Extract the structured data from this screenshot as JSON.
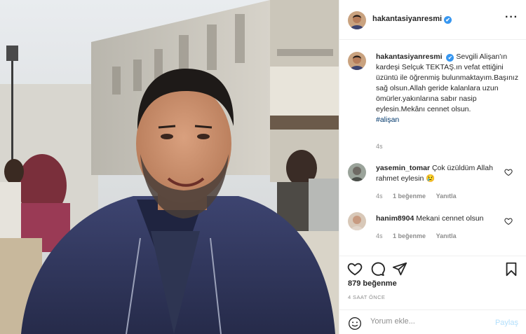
{
  "post": {
    "username": "hakantasiyanresmi",
    "verified_mark": "✔",
    "more_icon": "more-horizontal-icon",
    "colors": {
      "verified": "#3897f0",
      "link": "#00376b",
      "muted": "#8e8e8e",
      "border": "#efefef"
    }
  },
  "caption": {
    "username": "hakantasiyanresmi",
    "text": "Sevgili Alişan'ın kardeşi Selçuk TEKTAŞ.ın vefat ettiğini üzüntü ile öğrenmiş bulunmaktayım.Başınız sağ olsun.Allah geride kalanlara uzun ömürler.yakınlarına sabır nasip eylesin.Mekânı cennet olsun.",
    "hashtag": "#alişan",
    "time": "4s"
  },
  "comments": [
    {
      "username": "yasemin_tomar",
      "text": "Çok üzüldüm Allah rahmet eylesin 😢",
      "time": "4s",
      "likes": "1 beğenme",
      "reply": "Yanıtla"
    },
    {
      "username": "hanim8904",
      "text": "Mekani cennet olsun",
      "time": "4s",
      "likes": "1 beğenme",
      "reply": "Yanıtla"
    }
  ],
  "actions": {
    "icons": [
      "heart-icon",
      "comment-icon",
      "share-icon",
      "bookmark-icon"
    ],
    "likes": "879 beğenme",
    "post_time": "4 SAAT ÖNCE"
  },
  "comment_box": {
    "placeholder": "Yorum ekle...",
    "share_label": "Paylaş",
    "emoji_icon": "emoji-icon"
  }
}
